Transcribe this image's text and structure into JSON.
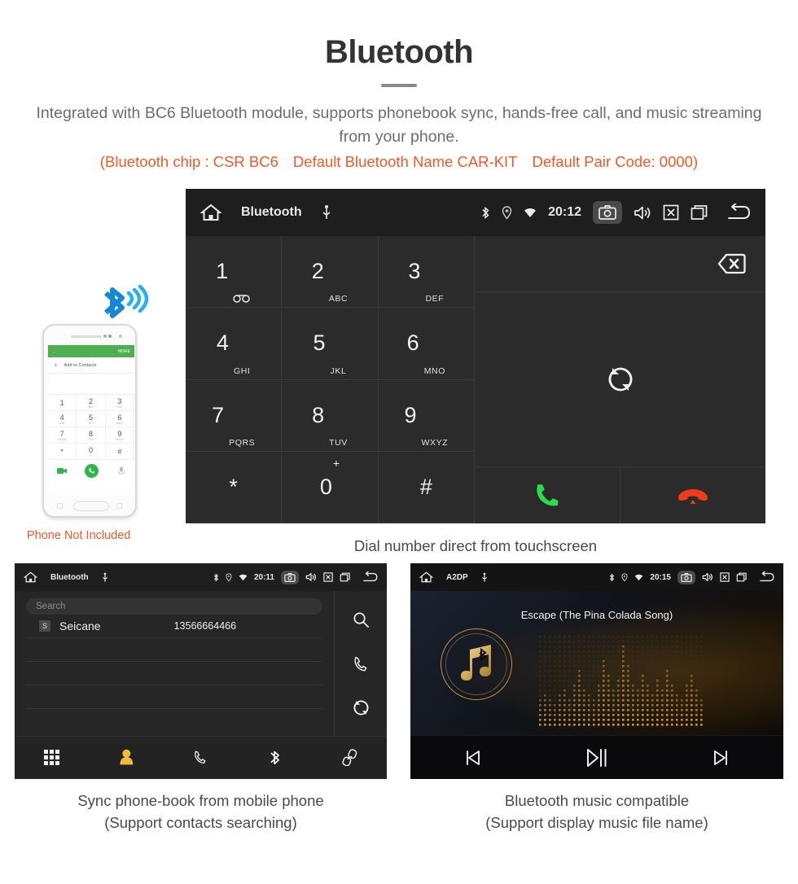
{
  "header": {
    "title": "Bluetooth",
    "subtitle": "Integrated with BC6 Bluetooth module, supports phonebook sync, hands-free call, and music streaming from your phone.",
    "spec_chip": "(Bluetooth chip : CSR BC6",
    "spec_name": "Default Bluetooth Name CAR-KIT",
    "spec_pair": "Default Pair Code: 0000)",
    "accent_color": "#f05a28",
    "text_color": "#6d6d6d"
  },
  "phone_mock": {
    "header_back": "←",
    "header_more": "MORE",
    "add_to_contacts": "Add to Contacts",
    "keys": [
      {
        "digit": "1",
        "letters": ""
      },
      {
        "digit": "2",
        "letters": "ABC"
      },
      {
        "digit": "3",
        "letters": "DEF"
      },
      {
        "digit": "4",
        "letters": "GHI"
      },
      {
        "digit": "5",
        "letters": "JKL"
      },
      {
        "digit": "6",
        "letters": "MNO"
      },
      {
        "digit": "7",
        "letters": "PQRS"
      },
      {
        "digit": "8",
        "letters": "TUV"
      },
      {
        "digit": "9",
        "letters": "WXYZ"
      },
      {
        "digit": "*",
        "letters": ""
      },
      {
        "digit": "0",
        "letters": "+"
      },
      {
        "digit": "#",
        "letters": ""
      }
    ],
    "note": "Phone Not Included",
    "note_color": "#f05a28",
    "bluetooth_logo_color": "#1ba3e8"
  },
  "dialer": {
    "statusbar": {
      "home_icon": "home-icon",
      "title": "Bluetooth",
      "usb_icon": "usb-icon",
      "bluetooth_icon": "bluetooth-icon",
      "location_icon": "location-icon",
      "wifi_icon": "wifi-icon",
      "time": "20:12",
      "camera_icon": "camera-icon",
      "volume_icon": "volume-icon",
      "close_icon": "close-box-icon",
      "recents_icon": "recents-icon",
      "back_icon": "back-icon"
    },
    "keys": [
      {
        "digit": "1",
        "letters": "",
        "voicemail": true
      },
      {
        "digit": "2",
        "letters": "ABC"
      },
      {
        "digit": "3",
        "letters": "DEF"
      },
      {
        "digit": "4",
        "letters": "GHI"
      },
      {
        "digit": "5",
        "letters": "JKL"
      },
      {
        "digit": "6",
        "letters": "MNO"
      },
      {
        "digit": "7",
        "letters": "PQRS"
      },
      {
        "digit": "8",
        "letters": "TUV"
      },
      {
        "digit": "9",
        "letters": "WXYZ"
      },
      {
        "digit": "*",
        "letters": ""
      },
      {
        "digit": "0",
        "letters": "",
        "plus": "+"
      },
      {
        "digit": "#",
        "letters": ""
      }
    ],
    "number_value": "",
    "backspace_icon": "backspace-icon",
    "sync_icon": "sync-icon",
    "call_icon": "call-icon",
    "hangup_icon": "hangup-icon",
    "call_color": "#2ddb4f",
    "hangup_color": "#ef3c18",
    "nav": [
      {
        "icon": "keypad-icon",
        "active": true
      },
      {
        "icon": "contact-icon",
        "active": false
      },
      {
        "icon": "phone-icon",
        "active": false
      },
      {
        "icon": "bluetooth-icon",
        "active": false
      },
      {
        "icon": "link-icon",
        "active": false
      }
    ],
    "active_color": "#f5b93c",
    "caption": "Dial number direct from touchscreen"
  },
  "phonebook": {
    "statusbar": {
      "title": "Bluetooth",
      "time": "20:11"
    },
    "search_placeholder": "Search",
    "contacts": [
      {
        "avatar": "S",
        "name": "Seicane",
        "number": "13566664466"
      }
    ],
    "empty_rows": 3,
    "side_actions": [
      {
        "icon": "search-icon"
      },
      {
        "icon": "phone-icon"
      },
      {
        "icon": "sync-icon"
      }
    ],
    "nav": [
      {
        "icon": "keypad-icon",
        "active": false
      },
      {
        "icon": "contact-icon",
        "active": true
      },
      {
        "icon": "phone-icon",
        "active": false
      },
      {
        "icon": "bluetooth-icon",
        "active": false
      },
      {
        "icon": "link-icon",
        "active": false
      }
    ],
    "caption_line1": "Sync phone-book from mobile phone",
    "caption_line2": "(Support contacts searching)"
  },
  "music": {
    "statusbar": {
      "title": "A2DP",
      "time": "20:15"
    },
    "song_title": "Escape (The Pina Colada Song)",
    "album_icon": "music-note-bluetooth-icon",
    "accent_color": "#c1913c",
    "controls": [
      {
        "icon": "previous-icon"
      },
      {
        "icon": "play-pause-icon"
      },
      {
        "icon": "next-icon"
      }
    ],
    "caption_line1": "Bluetooth music compatible",
    "caption_line2": "(Support display music file name)"
  }
}
